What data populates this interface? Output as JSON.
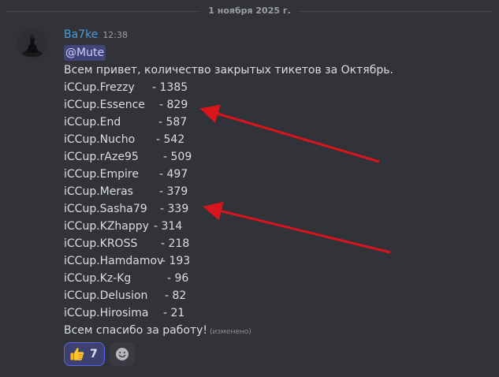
{
  "date_divider": "1 ноября 2025 г.",
  "message": {
    "author": "Ba7ke",
    "time": "12:38",
    "mention": "@Mute",
    "intro": "Всем привет, количество закрытых тикетов за Октябрь.",
    "tickets": [
      {
        "name": "iCCup.Frezzy",
        "count": "- 1385"
      },
      {
        "name": "iCCup.Essence",
        "count": "- 829"
      },
      {
        "name": "iCCup.End",
        "count": "- 587"
      },
      {
        "name": "iCCup.Nucho",
        "count": "- 542"
      },
      {
        "name": "iCCup.rAze95",
        "count": "- 509"
      },
      {
        "name": "iCCup.Empire",
        "count": "- 497"
      },
      {
        "name": "iCCup.Meras",
        "count": "- 379"
      },
      {
        "name": "iCCup.Sasha79",
        "count": "- 339"
      },
      {
        "name": "iCCup.KZhappy",
        "count": "- 314"
      },
      {
        "name": "iCCup.KROSS",
        "count": "- 218"
      },
      {
        "name": "iCCup.Hamdamov",
        "count": "- 193"
      },
      {
        "name": "iCCup.Kz-Kg",
        "count": "- 96"
      },
      {
        "name": "iCCup.Delusion",
        "count": "- 82"
      },
      {
        "name": "iCCup.Hirosima",
        "count": "- 21"
      }
    ],
    "outro": "Всем спасибо за работу!",
    "edited": "(изменено)"
  },
  "reactions": [
    {
      "emoji": "thumbs-up-icon",
      "count": "7",
      "active": true
    }
  ],
  "colors": {
    "background": "#323339",
    "username": "#4b9bd6",
    "mention_bg": "#41447a",
    "reaction_active_border": "#5865f2",
    "annotation_arrow": "#d8151c"
  },
  "annotations": {
    "arrows_point_to": [
      "iCCup.Essence",
      "iCCup.Sasha79"
    ]
  }
}
